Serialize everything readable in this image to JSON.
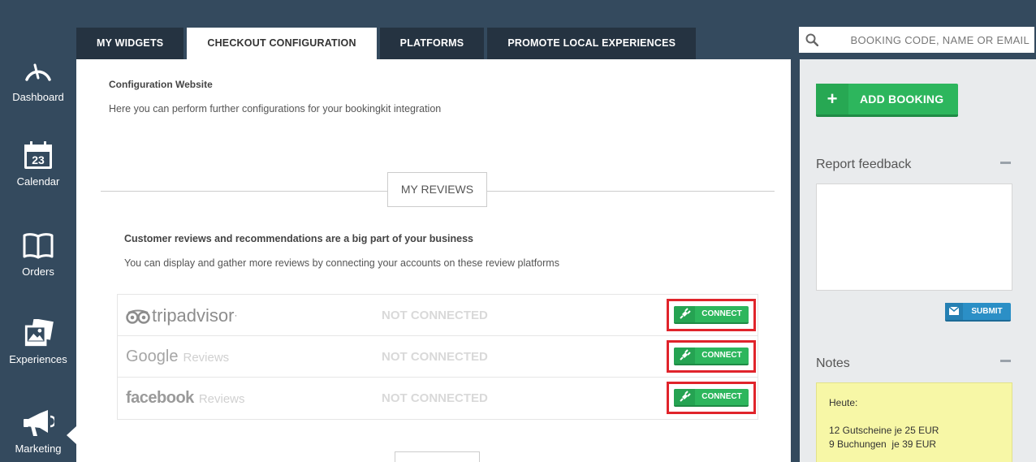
{
  "sidebar": {
    "items": [
      {
        "label": "Dashboard",
        "icon": "speedometer-icon"
      },
      {
        "label": "Calendar",
        "icon": "calendar-icon",
        "day": "23"
      },
      {
        "label": "Orders",
        "icon": "book-icon"
      },
      {
        "label": "Experiences",
        "icon": "photos-icon"
      },
      {
        "label": "Marketing",
        "icon": "megaphone-icon"
      }
    ]
  },
  "tabs": [
    {
      "label": "MY WIDGETS"
    },
    {
      "label": "CHECKOUT CONFIGURATION"
    },
    {
      "label": "PLATFORMS"
    },
    {
      "label": "PROMOTE LOCAL EXPERIENCES"
    }
  ],
  "main": {
    "config_title": "Configuration Website",
    "config_desc": "Here you can perform further configurations for your bookingkit integration",
    "section_label": "MY REVIEWS",
    "reviews_title": "Customer reviews and recommendations are a big part of your business",
    "reviews_desc": "You can display and gather more reviews by connecting your accounts on these review platforms",
    "platforms": [
      {
        "logo": "tripadvisor",
        "logo_suffix": "·",
        "status": "NOT CONNECTED",
        "button": "CONNECT"
      },
      {
        "logo": "Google",
        "logo_suffix": "Reviews",
        "status": "NOT CONNECTED",
        "button": "CONNECT"
      },
      {
        "logo": "facebook",
        "logo_suffix": "Reviews",
        "status": "NOT CONNECTED",
        "button": "CONNECT"
      }
    ]
  },
  "search": {
    "placeholder": "BOOKING CODE, NAME OR EMAIL"
  },
  "right": {
    "add_booking_label": "ADD BOOKING",
    "add_booking_plus": "+",
    "feedback_title": "Report feedback",
    "submit_label": "SUBMIT",
    "notes_title": "Notes",
    "notes_lines": [
      "Heute:",
      "",
      "12 Gutscheine je 25 EUR",
      "9 Buchungen  je 39 EUR"
    ]
  },
  "colors": {
    "sidebar_bg": "#344a5e",
    "tab_bg": "#253341",
    "green": "#2db65d",
    "blue": "#2b8fc6",
    "highlight_red": "#e0242b",
    "notes_yellow": "#f7f7a6"
  }
}
